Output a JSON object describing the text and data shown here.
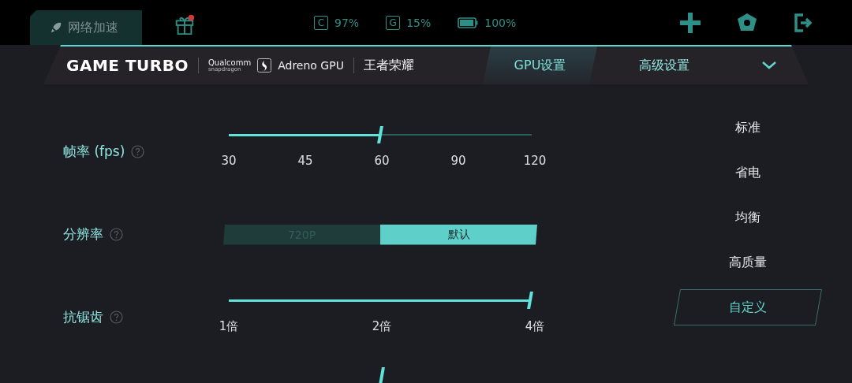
{
  "top_bar": {
    "boost_button": "网络加速",
    "gift": {
      "has_badge": true
    },
    "stats": [
      {
        "kind": "cpu",
        "icon_letter": "C",
        "value": "97%"
      },
      {
        "kind": "gpu",
        "icon_letter": "G",
        "value": "15%"
      },
      {
        "kind": "battery",
        "value": "100%",
        "level": 0.95
      }
    ]
  },
  "header": {
    "title": "GAME TURBO",
    "chip_brand": "Qualcomm",
    "chip_line": "snapdragon",
    "gpu": "Adreno GPU",
    "game": "王者荣耀",
    "tabs": [
      {
        "label": "GPU设置",
        "selected": true
      },
      {
        "label": "高级设置",
        "selected": false
      }
    ]
  },
  "settings": [
    {
      "kind": "slider",
      "label": "帧率 (fps)",
      "level": 0.5,
      "ticks": [
        "30",
        "45",
        "60",
        "90",
        "120"
      ]
    },
    {
      "kind": "segmented",
      "label": "分辨率",
      "options": [
        {
          "label": "720P",
          "selected": false
        },
        {
          "label": "默认",
          "selected": true
        }
      ]
    },
    {
      "kind": "slider",
      "label": "抗锯齿",
      "level": 1,
      "ticks": [
        "1倍",
        "2倍",
        "4倍"
      ]
    }
  ],
  "partial_slider": {
    "level": 0.5
  },
  "modes": [
    {
      "label": "标准",
      "selected": false
    },
    {
      "label": "省电",
      "selected": false
    },
    {
      "label": "均衡",
      "selected": false
    },
    {
      "label": "高质量",
      "selected": false
    },
    {
      "label": "自定义",
      "selected": true
    }
  ]
}
